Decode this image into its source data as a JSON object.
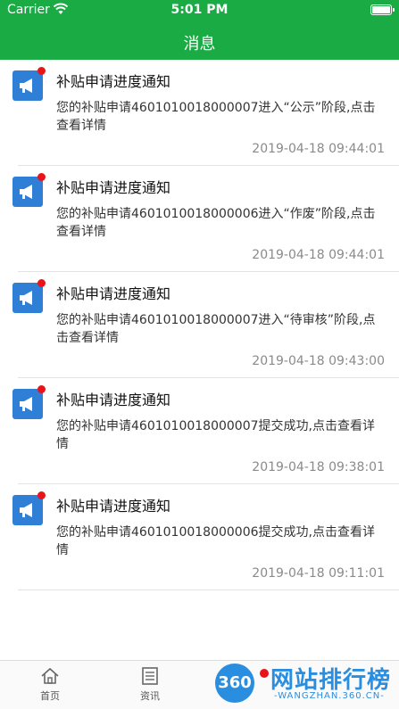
{
  "status_bar": {
    "carrier": "Carrier",
    "time": "5:01 PM"
  },
  "nav": {
    "title": "消息"
  },
  "messages": [
    {
      "title": "补贴申请进度通知",
      "body": "您的补贴申请4601010018000007进入“公示”阶段,点击查看详情",
      "time": "2019-04-18 09:44:01",
      "unread": true
    },
    {
      "title": "补贴申请进度通知",
      "body": "您的补贴申请4601010018000006进入“作废”阶段,点击查看详情",
      "time": "2019-04-18 09:44:01",
      "unread": true
    },
    {
      "title": "补贴申请进度通知",
      "body": "您的补贴申请4601010018000007进入“待审核”阶段,点击查看详情",
      "time": "2019-04-18 09:43:00",
      "unread": true
    },
    {
      "title": "补贴申请进度通知",
      "body": "您的补贴申请4601010018000007提交成功,点击查看详情",
      "time": "2019-04-18 09:38:01",
      "unread": true
    },
    {
      "title": "补贴申请进度通知",
      "body": "您的补贴申请4601010018000006提交成功,点击查看详情",
      "time": "2019-04-18 09:11:01",
      "unread": true
    }
  ],
  "tabs": [
    {
      "label": "首页",
      "icon": "home-icon"
    },
    {
      "label": "资讯",
      "icon": "news-icon"
    }
  ],
  "watermark": {
    "logo": "360",
    "text": "网站排行榜",
    "sub": "-WANGZHAN.360.CN-"
  },
  "colors": {
    "header": "#1aab45",
    "icon_bg": "#2f7fd6",
    "unread_dot": "#e8141a"
  }
}
